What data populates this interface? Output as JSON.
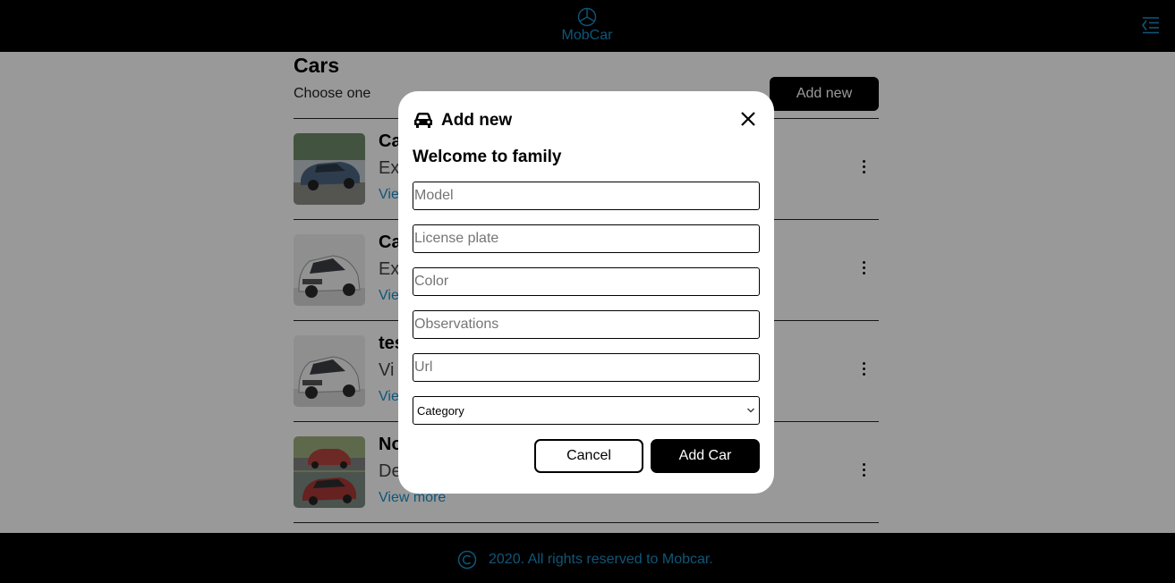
{
  "app": {
    "name": "MobCar",
    "accent_color": "#1a8fc9",
    "logo_icon": "mercedes-star-icon",
    "menu_icon": "menu-indent-icon"
  },
  "page": {
    "title": "Cars",
    "subtitle": "Choose one",
    "add_new_label": "Add new"
  },
  "cars": [
    {
      "name": "Ca",
      "description": "Ex",
      "link": "View",
      "thumbnail": "blue-sedan"
    },
    {
      "name": "Ca",
      "description": "Ex",
      "link": "View",
      "thumbnail": "white-hatchback"
    },
    {
      "name": "tes",
      "description": "Vi",
      "link": "View",
      "thumbnail": "white-hatchback"
    },
    {
      "name": "No",
      "description": "De",
      "link": "View more",
      "thumbnail": "red-hatchbacks"
    }
  ],
  "footer": {
    "text": "2020. All rights reserved to Mobcar.",
    "icon": "copyright-icon"
  },
  "modal": {
    "title": "Add new",
    "icon": "car-icon",
    "subtitle": "Welcome to family",
    "fields": {
      "model": {
        "placeholder": "Model",
        "value": ""
      },
      "license_plate": {
        "placeholder": "License plate",
        "value": ""
      },
      "color": {
        "placeholder": "Color",
        "value": ""
      },
      "observations": {
        "placeholder": "Observations",
        "value": ""
      },
      "url": {
        "placeholder": "Url",
        "value": ""
      }
    },
    "category": {
      "selected": "Category"
    },
    "cancel_label": "Cancel",
    "submit_label": "Add Car"
  }
}
